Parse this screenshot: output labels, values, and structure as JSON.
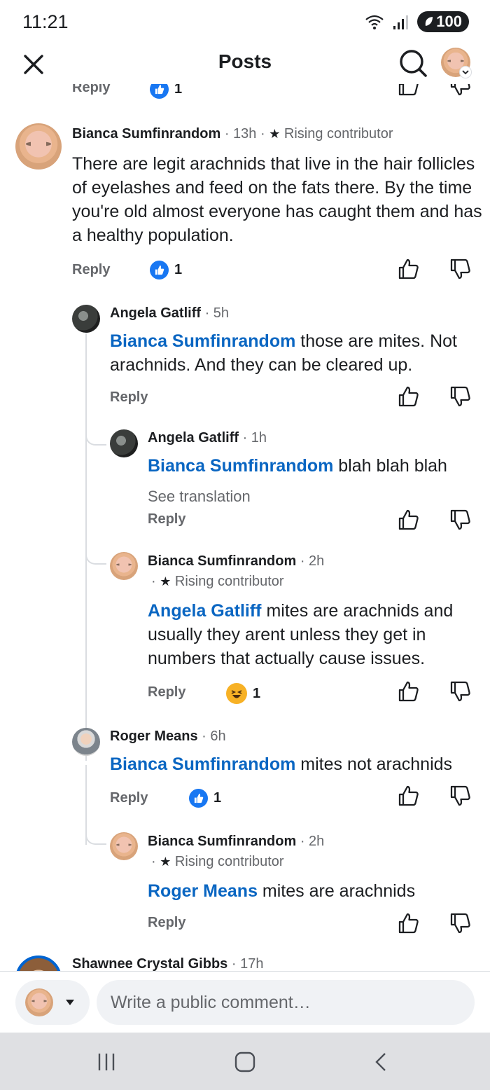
{
  "status": {
    "time": "11:21",
    "battery": "100"
  },
  "header": {
    "title": "Posts"
  },
  "partial_top": {
    "reply_label": "Reply",
    "like_count": "1"
  },
  "comments": [
    {
      "author": "Bianca Sumfinrandom",
      "time": " · 13h ·",
      "badge": "Rising contributor",
      "text": "There are legit arachnids that live in the hair follicles of eyelashes and feed on the fats there. By the time you're old almost everyone has caught them and has a healthy population.",
      "reply_label": "Reply",
      "like_count": "1"
    },
    {
      "author": "Angela Gatliff",
      "time": " · 5h",
      "mention": "Bianca Sumfinrandom",
      "text": " those are mites. Not arachnids. And they can be cleared up.",
      "reply_label": "Reply"
    },
    {
      "author": "Angela Gatliff",
      "time": " · 1h",
      "mention": "Bianca Sumfinrandom",
      "text": " blah blah blah",
      "see_translation": "See translation",
      "reply_label": "Reply"
    },
    {
      "author": "Bianca Sumfinrandom",
      "time": " · 2h",
      "badge": "Rising contributor",
      "mention": "Angela Gatliff",
      "text": " mites are arachnids and usually they arent unless they get in numbers that actually cause issues.",
      "reply_label": "Reply",
      "reaction_count": "1"
    },
    {
      "author": "Roger Means",
      "time": " · 6h",
      "mention": "Bianca Sumfinrandom",
      "text": " mites not arachnids",
      "reply_label": "Reply",
      "like_count": "1"
    },
    {
      "author": "Bianca Sumfinrandom",
      "time": " · 2h",
      "badge": "Rising contributor",
      "mention": "Roger Means",
      "text": " mites are arachnids",
      "reply_label": "Reply"
    },
    {
      "author": "Shawnee Crystal Gibbs",
      "time": " · 17h"
    }
  ],
  "composer": {
    "placeholder": "Write a public comment…"
  },
  "colors": {
    "accent": "#0a66c2",
    "like": "#1877f2",
    "muted": "#65676b"
  }
}
